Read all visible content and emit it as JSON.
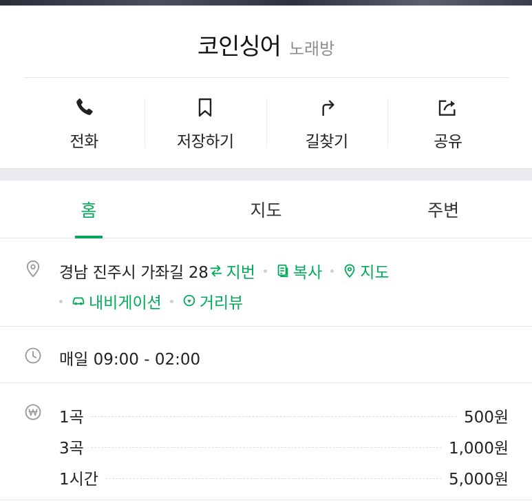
{
  "place": {
    "name": "코인싱어",
    "category": "노래방"
  },
  "actions": [
    {
      "label": "전화",
      "icon": "phone-icon"
    },
    {
      "label": "저장하기",
      "icon": "bookmark-icon"
    },
    {
      "label": "길찾기",
      "icon": "directions-icon"
    },
    {
      "label": "공유",
      "icon": "share-icon"
    }
  ],
  "tabs": [
    {
      "label": "홈",
      "active": true
    },
    {
      "label": "지도",
      "active": false
    },
    {
      "label": "주변",
      "active": false
    }
  ],
  "address": {
    "text": "경남 진주시 가좌길 28",
    "links": {
      "jibun": "지번",
      "copy": "복사",
      "map": "지도",
      "navigation": "내비게이션",
      "streetview": "거리뷰"
    }
  },
  "hours": {
    "text": "매일 09:00 - 02:00"
  },
  "prices": [
    {
      "name": "1곡",
      "value": "500원"
    },
    {
      "name": "3곡",
      "value": "1,000원"
    },
    {
      "name": "1시간",
      "value": "5,000원"
    }
  ],
  "colors": {
    "accent": "#03aa5a",
    "text": "#222222",
    "muted": "#8e8e8e",
    "divider": "#e8e8e8"
  }
}
